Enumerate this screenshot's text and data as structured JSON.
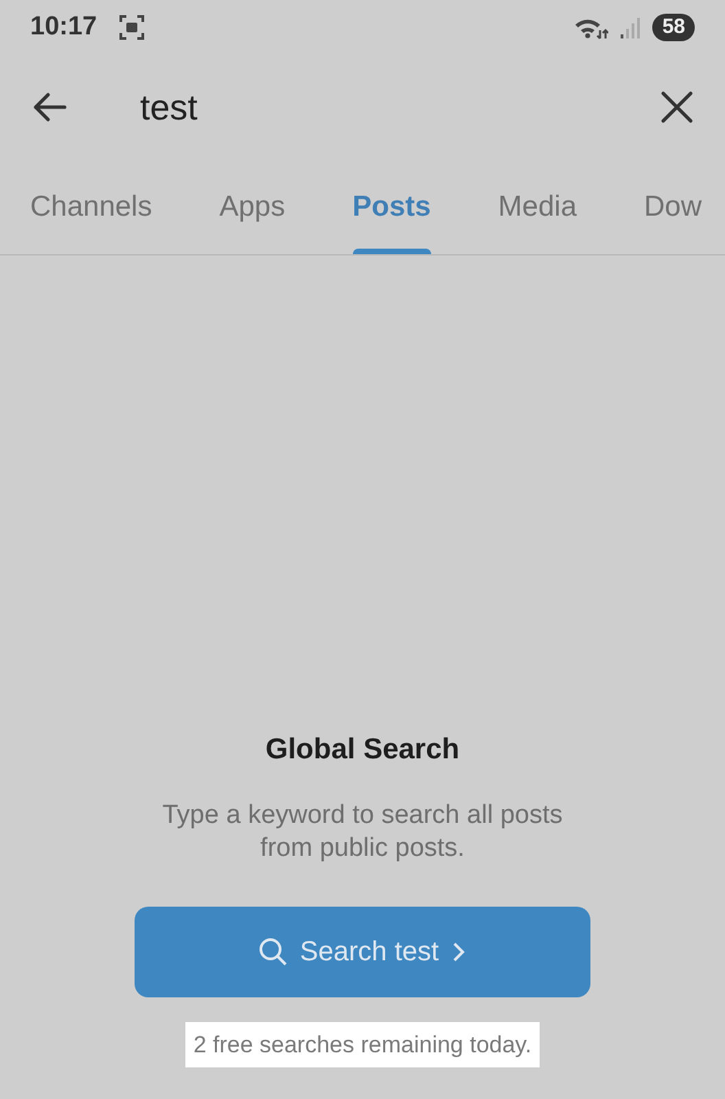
{
  "status_bar": {
    "time": "10:17",
    "battery": "58"
  },
  "search": {
    "value": "test"
  },
  "tabs": [
    {
      "label": "Channels",
      "selected": false
    },
    {
      "label": "Apps",
      "selected": false
    },
    {
      "label": "Posts",
      "selected": true
    },
    {
      "label": "Media",
      "selected": false
    },
    {
      "label": "Dow",
      "selected": false
    }
  ],
  "empty_state": {
    "title": "Global Search",
    "description": "Type a keyword to search all posts from public posts.",
    "button": "Search test",
    "note": "2 free searches remaining today."
  }
}
